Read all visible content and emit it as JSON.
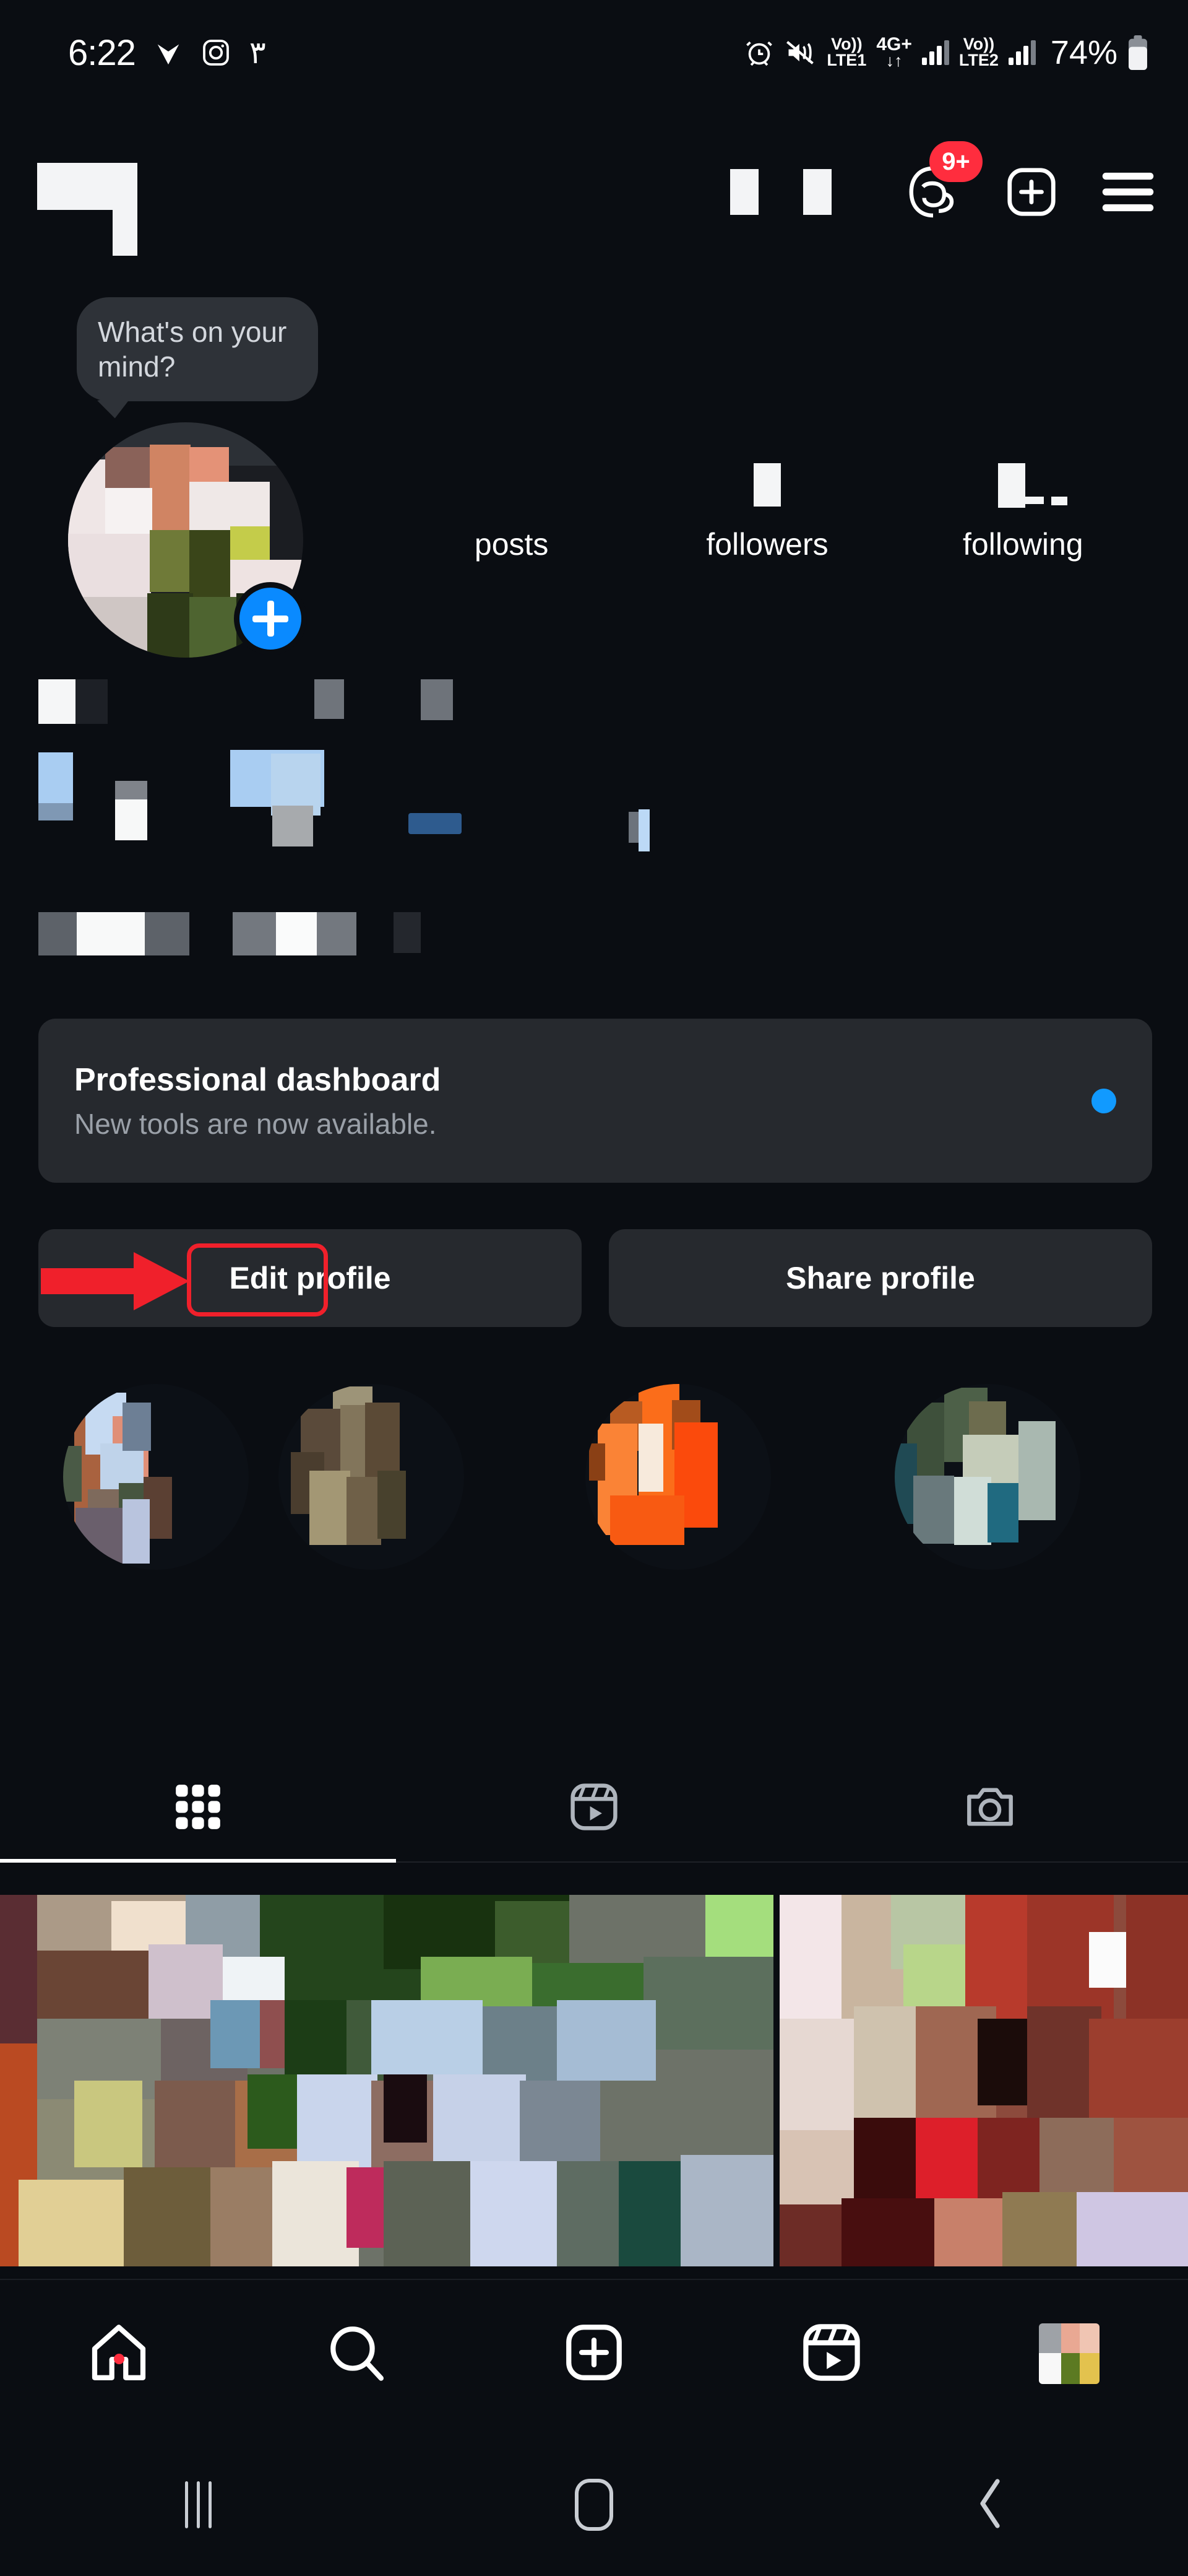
{
  "statusbar": {
    "time": "6:22",
    "left_icons": [
      "check-mark-icon",
      "instagram-icon"
    ],
    "arabic_numeral": "۳",
    "alarm": "alarm-icon",
    "mute": "vibrate-mute-icon",
    "volte1_top": "Vo))",
    "volte1_bottom": "LTE1",
    "network_top": "4G+",
    "network_bottom": "↓↑",
    "volte2_top": "Vo))",
    "volte2_bottom": "LTE2",
    "battery_percent": "74%",
    "battery_icon": "battery-icon"
  },
  "header": {
    "username": "",
    "username_state": "redacted",
    "threads_icon": "threads-icon",
    "threads_badge": "9+",
    "create_icon": "plus-square-icon",
    "menu_icon": "hamburger-menu-icon"
  },
  "tooltip": {
    "text": "What's on your mind?"
  },
  "profile": {
    "avatar_name": "profile-avatar",
    "add_story_icon": "add-story-plus-icon",
    "stats": [
      {
        "count": "",
        "label": "posts"
      },
      {
        "count": "",
        "label": "followers"
      },
      {
        "count": "",
        "label": "following"
      }
    ],
    "bio_state": "redacted"
  },
  "dashboard": {
    "title": "Professional dashboard",
    "subtitle": "New tools are now available.",
    "dot_color": "#119aff"
  },
  "actions": {
    "edit_profile": "Edit profile",
    "share_profile": "Share profile",
    "annotation_color": "#f0202b",
    "annotation_target": "edit-profile-button"
  },
  "highlights": {
    "count": 4,
    "labels": [
      "",
      "",
      "",
      ""
    ]
  },
  "tabs": [
    {
      "icon": "grid-icon",
      "name": "posts-tab",
      "active": true
    },
    {
      "icon": "reels-icon",
      "name": "reels-tab",
      "active": false
    },
    {
      "icon": "tagged-icon",
      "name": "tagged-tab",
      "active": false
    }
  ],
  "grid": {
    "visible_posts": 2
  },
  "bottomnav": [
    {
      "icon": "home-icon",
      "name": "nav-home",
      "active": true,
      "has_dot": true
    },
    {
      "icon": "search-icon",
      "name": "nav-search",
      "active": false,
      "has_dot": false
    },
    {
      "icon": "plus-square-icon",
      "name": "nav-create",
      "active": false,
      "has_dot": false
    },
    {
      "icon": "reels-icon",
      "name": "nav-reels",
      "active": false,
      "has_dot": false
    },
    {
      "icon": "avatar-icon",
      "name": "nav-profile",
      "active": false,
      "has_dot": false
    }
  ],
  "androidnav": {
    "recents": "recents-icon",
    "home": "home-pill-icon",
    "back": "back-chevron-icon"
  },
  "colors": {
    "background": "#0a0d12",
    "card": "#26292e",
    "accent_blue": "#0a8aff",
    "badge_red": "#ff2d3e",
    "annotation_red": "#f0202b",
    "muted_text": "#9aa0a8"
  }
}
